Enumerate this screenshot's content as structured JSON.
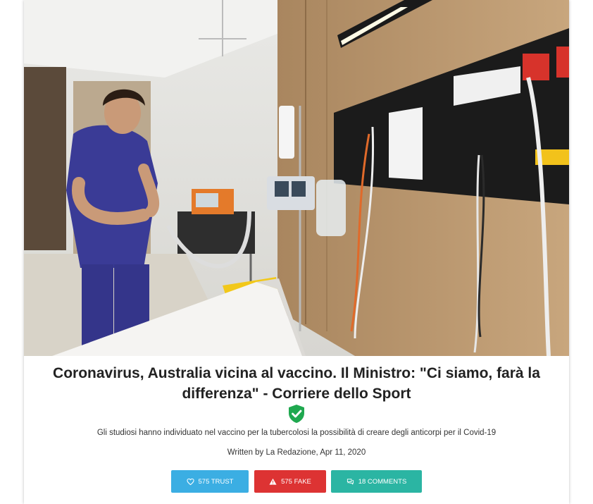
{
  "article": {
    "title": "Coronavirus, Australia vicina al vaccino. Il Ministro: \"Ci siamo, farà la differenza\" - Corriere dello Sport",
    "subtitle": "Gli studiosi hanno individuato nel vaccino per la tubercolosi la possibilità di creare degli anticorpi per il Covid-19",
    "byline": "Written by La Redazione, Apr 11, 2020",
    "verified_icon": "verified-shield-icon"
  },
  "actions": {
    "trust_label": "575 TRUST",
    "fake_label": "575 FAKE",
    "comments_label": "18 COMMENTS"
  },
  "colors": {
    "trust": "#3baee3",
    "fake": "#dd3333",
    "comments": "#2bb5a3",
    "verified": "#1fa84f"
  }
}
